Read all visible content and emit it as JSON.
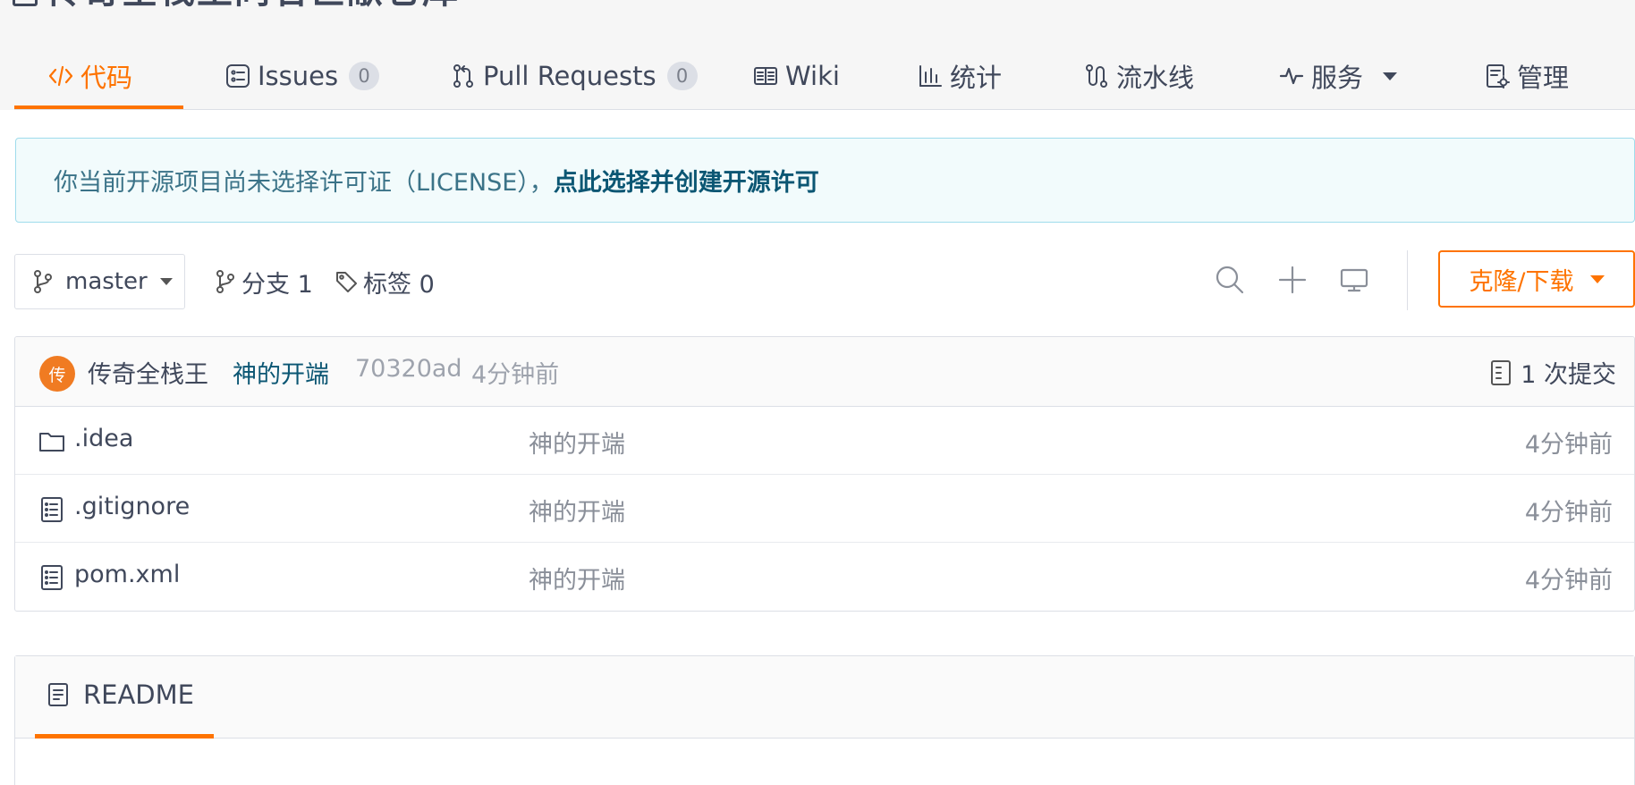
{
  "repo": {
    "title": "传奇全栈王同名巨献仓库"
  },
  "tabs": [
    {
      "label": "代码",
      "icon": "code-icon",
      "active": true
    },
    {
      "label": "Issues",
      "icon": "issues-icon",
      "count": "0"
    },
    {
      "label": "Pull Requests",
      "icon": "pull-request-icon",
      "count": "0"
    },
    {
      "label": "Wiki",
      "icon": "wiki-icon"
    },
    {
      "label": "统计",
      "icon": "stats-icon"
    },
    {
      "label": "流水线",
      "icon": "pipeline-icon"
    },
    {
      "label": "服务",
      "icon": "service-icon",
      "dropdown": true
    },
    {
      "label": "管理",
      "icon": "manage-icon"
    }
  ],
  "notice": {
    "text": "你当前开源项目尚未选择许可证（LICENSE），",
    "link": "点此选择并创建开源许可"
  },
  "branch": {
    "current": "master",
    "branches_label": "分支 1",
    "tags_label": "标签 0"
  },
  "toolbar": {
    "search_icon": "search-icon",
    "add_icon": "plus-icon",
    "webide_icon": "monitor-icon",
    "clone_label": "克隆/下载"
  },
  "last_commit": {
    "avatar_text": "传",
    "author": "传奇全栈王",
    "message": "神的开端",
    "hash": "70320ad",
    "time": "4分钟前",
    "count_label": "1 次提交"
  },
  "files": [
    {
      "name": ".idea",
      "type": "folder",
      "message": "神的开端",
      "time": "4分钟前"
    },
    {
      "name": ".gitignore",
      "type": "file",
      "message": "神的开端",
      "time": "4分钟前"
    },
    {
      "name": "pom.xml",
      "type": "file",
      "message": "神的开端",
      "time": "4分钟前"
    }
  ],
  "readme": {
    "title": "README"
  },
  "colors": {
    "accent": "#fe7300",
    "notice_bg": "#f2fbfc",
    "notice_link": "#0b5673",
    "avatar": "#f07b22"
  }
}
